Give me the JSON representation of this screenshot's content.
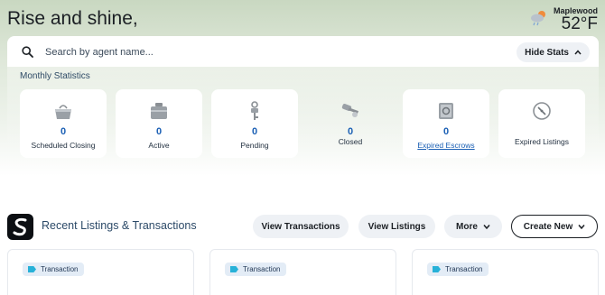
{
  "greeting": "Rise and shine,",
  "weather": {
    "city": "Maplewood",
    "temp": "52°F",
    "icon": "cloud-rain-sun-icon"
  },
  "search": {
    "placeholder": "Search by agent name..."
  },
  "stats_toggle": "Hide Stats",
  "stats": {
    "title": "Monthly Statistics",
    "items": [
      {
        "value": "0",
        "label": "Scheduled Closing",
        "icon": "handbag-icon"
      },
      {
        "value": "0",
        "label": "Active",
        "icon": "folder-icon"
      },
      {
        "value": "0",
        "label": "Pending",
        "icon": "key-icon"
      },
      {
        "value": "0",
        "label": "Closed",
        "icon": "keys-icon"
      },
      {
        "value": "0",
        "label": "Expired Escrows",
        "icon": "safe-icon"
      },
      {
        "label": "Expired Listings",
        "icon": "compass-icon"
      }
    ]
  },
  "section": {
    "title": "Recent Listings & Transactions",
    "buttons": {
      "view_transactions": "View Transactions",
      "view_listings": "View Listings",
      "more": "More",
      "create_new": "Create New"
    }
  },
  "cards": [
    {
      "badge": "Transaction"
    },
    {
      "badge": "Transaction"
    },
    {
      "badge": "Transaction"
    }
  ],
  "colors": {
    "accent": "#1a5fb4",
    "badge_tag": "#27b1d8"
  }
}
